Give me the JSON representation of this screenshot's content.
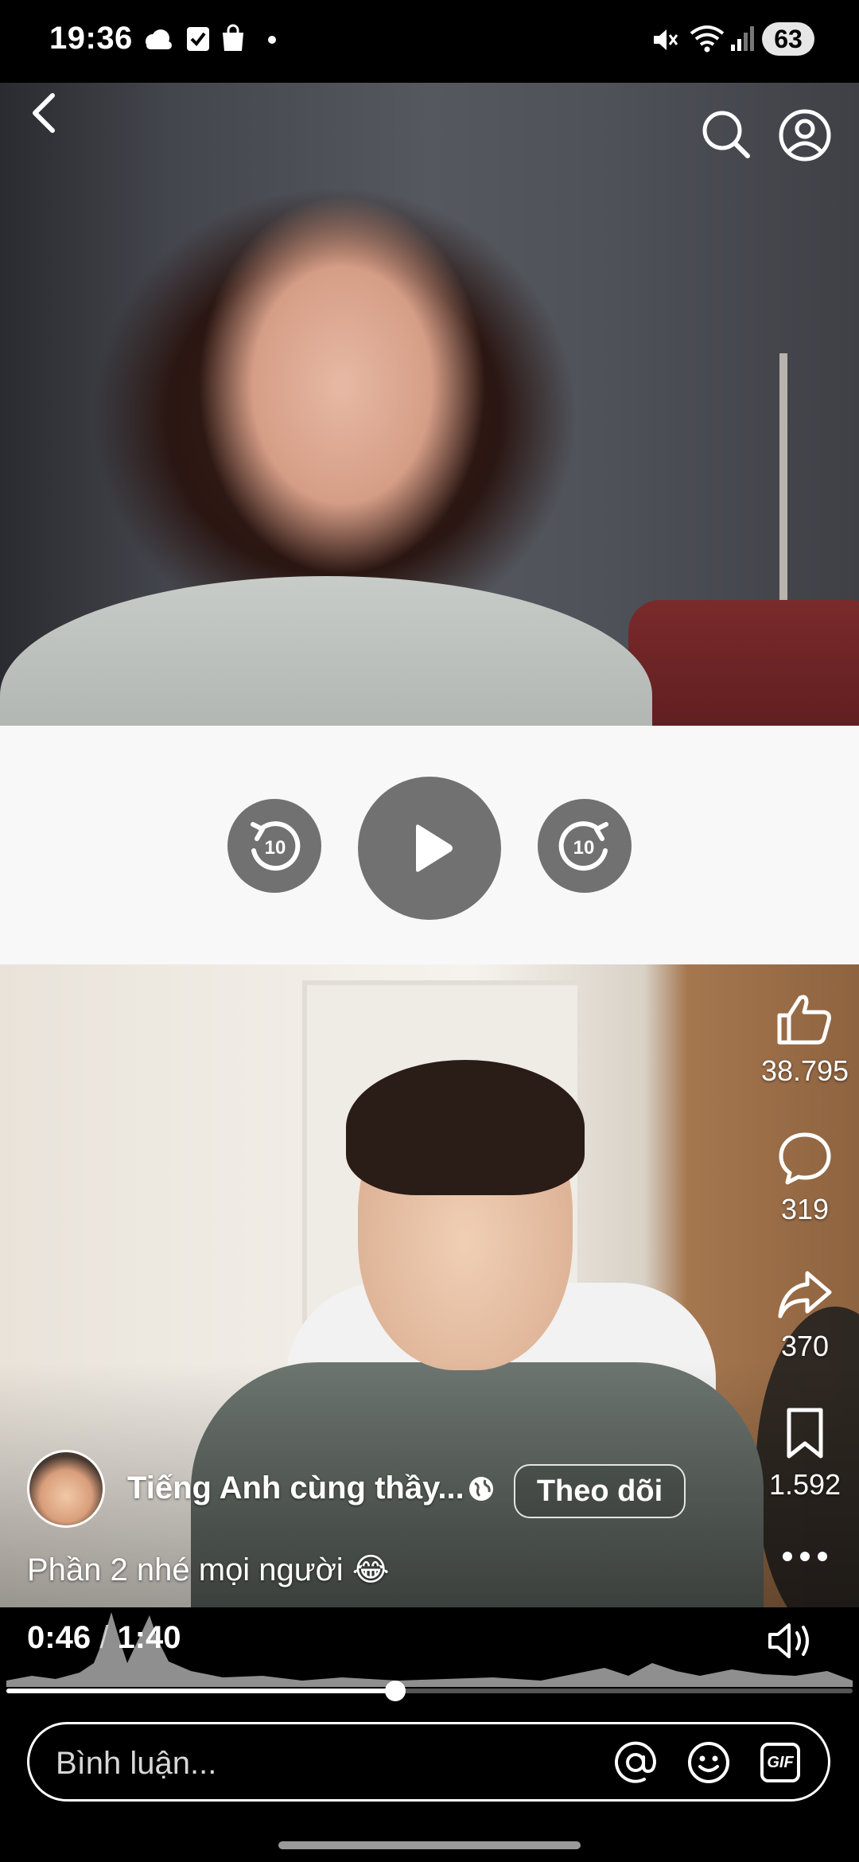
{
  "status_bar": {
    "time": "19:36",
    "battery": "63",
    "left_icons": [
      "weather-icon",
      "checkbox-icon",
      "shopping-bag-icon",
      "dot-icon"
    ],
    "right_icons": [
      "mute-icon",
      "wifi-icon",
      "signal-icon",
      "battery-icon"
    ]
  },
  "header": {
    "icons": [
      "back-icon",
      "search-icon",
      "profile-icon"
    ]
  },
  "player_controls": {
    "rewind_seconds": "10",
    "forward_seconds": "10"
  },
  "actions": {
    "likes": "38.795",
    "comments": "319",
    "shares": "370",
    "saves": "1.592"
  },
  "post": {
    "channel_name": "Tiếng Anh cùng thầy...",
    "follow_label": "Theo dõi",
    "caption": "Phần 2 nhé mọi người 😂"
  },
  "playback": {
    "current_time": "0:46",
    "separator": "/",
    "duration": "1:40",
    "progress": 0.46
  },
  "comment": {
    "placeholder": "Bình luận...",
    "gif_label": "GIF"
  },
  "colors": {
    "control_button": "#717171",
    "control_background": "#f8f8f8"
  }
}
